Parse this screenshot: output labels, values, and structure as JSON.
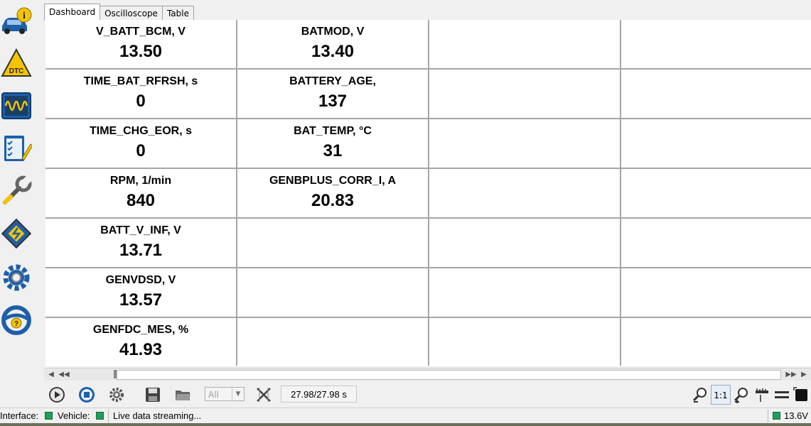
{
  "tabs": [
    "Dashboard",
    "Oscilloscope",
    "Table"
  ],
  "sidebar_icons": [
    "vehicle-info-icon",
    "dtc-icon",
    "oscilloscope-icon",
    "checklist-icon",
    "wrench-icon",
    "chip-icon",
    "gear-icon",
    "help-wheel-icon"
  ],
  "cells": [
    [
      {
        "label": "V_BATT_BCM, V",
        "value": "13.50"
      },
      {
        "label": "BATMOD, V",
        "value": "13.40"
      },
      {
        "label": "",
        "value": ""
      },
      {
        "label": "",
        "value": ""
      }
    ],
    [
      {
        "label": "TIME_BAT_RFRSH, s",
        "value": "0"
      },
      {
        "label": "BATTERY_AGE,",
        "value": "137"
      },
      {
        "label": "",
        "value": ""
      },
      {
        "label": "",
        "value": ""
      }
    ],
    [
      {
        "label": "TIME_CHG_EOR, s",
        "value": "0"
      },
      {
        "label": "BAT_TEMP, °C",
        "value": "31"
      },
      {
        "label": "",
        "value": ""
      },
      {
        "label": "",
        "value": ""
      }
    ],
    [
      {
        "label": "RPM, 1/min",
        "value": "840"
      },
      {
        "label": "GENBPLUS_CORR_I, A",
        "value": "20.83"
      },
      {
        "label": "",
        "value": ""
      },
      {
        "label": "",
        "value": ""
      }
    ],
    [
      {
        "label": "BATT_V_INF, V",
        "value": "13.71"
      },
      {
        "label": "",
        "value": ""
      },
      {
        "label": "",
        "value": ""
      },
      {
        "label": "",
        "value": ""
      }
    ],
    [
      {
        "label": "GENVDSD, V",
        "value": "13.57"
      },
      {
        "label": "",
        "value": ""
      },
      {
        "label": "",
        "value": ""
      },
      {
        "label": "",
        "value": ""
      }
    ],
    [
      {
        "label": "GENFDC_MES, %",
        "value": "41.93"
      },
      {
        "label": "",
        "value": ""
      },
      {
        "label": "",
        "value": ""
      },
      {
        "label": "",
        "value": ""
      }
    ]
  ],
  "toolbar": {
    "filter_value": "All",
    "time_display": "27.98/27.98 s",
    "zoom_ratio": "1:1"
  },
  "status": {
    "interface_label": "Interface:",
    "vehicle_label": "Vehicle:",
    "message": "Live data streaming...",
    "voltage": "13.6V",
    "led_color": "#1ea05a"
  },
  "colors": {
    "accent_blue": "#1d5fa8",
    "icon_yellow": "#f5c400",
    "grid_line": "#a6a6a6"
  }
}
